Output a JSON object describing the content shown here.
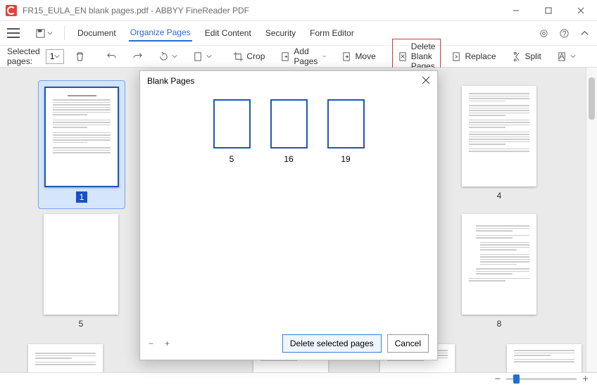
{
  "window": {
    "title": "FR15_EULA_EN blank pages.pdf - ABBYY FineReader PDF"
  },
  "menu": {
    "document": "Document",
    "organize": "Organize Pages",
    "edit": "Edit Content",
    "security": "Security",
    "form": "Form Editor"
  },
  "toolbar": {
    "selected_label": "Selected pages:",
    "selected_value": "1",
    "crop": "Crop",
    "add_pages": "Add Pages",
    "move": "Move",
    "delete_blank": "Delete Blank Pages",
    "replace": "Replace",
    "split": "Split"
  },
  "thumbnails": {
    "p1": "1",
    "p4": "4",
    "p5": "5",
    "p8": "8"
  },
  "dialog": {
    "title": "Blank Pages",
    "pages": {
      "a": "5",
      "b": "16",
      "c": "19"
    },
    "delete": "Delete selected pages",
    "cancel": "Cancel"
  }
}
